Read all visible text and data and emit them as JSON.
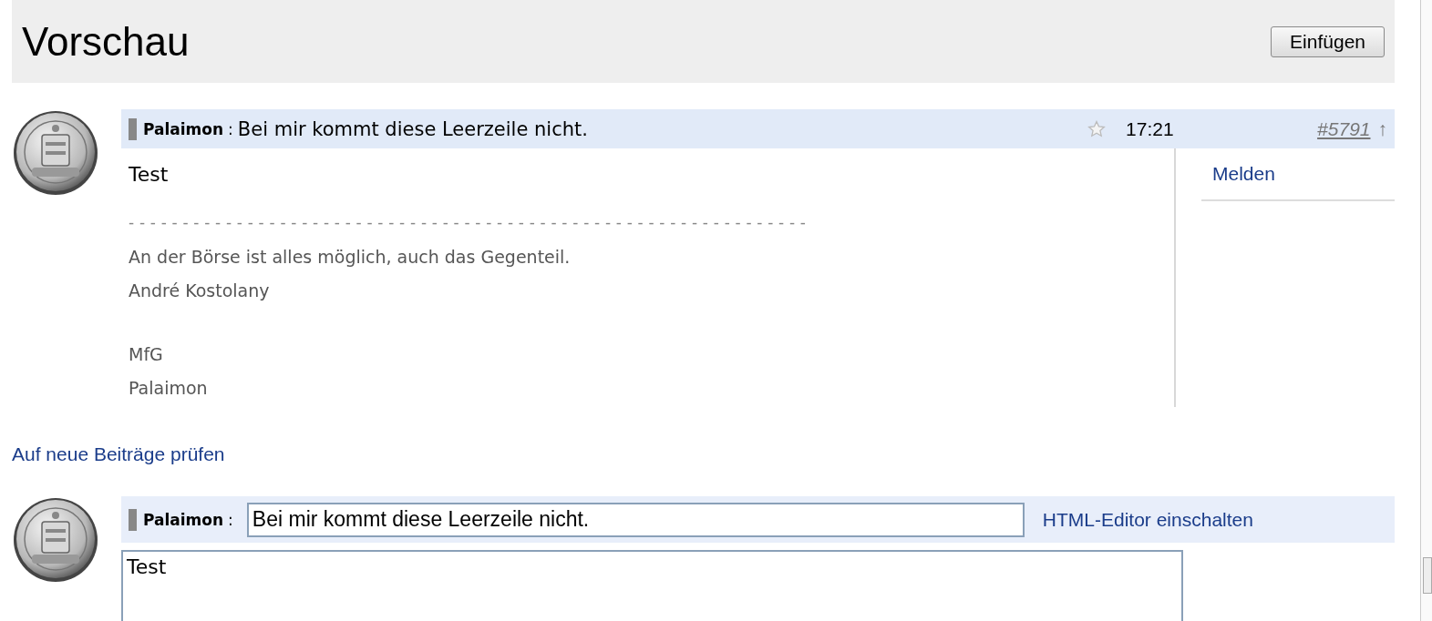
{
  "header": {
    "title": "Vorschau",
    "button": "Einfügen"
  },
  "post": {
    "author": "Palaimon",
    "separator": ":",
    "subject": "Bei mir kommt diese Leerzeile nicht.",
    "time": "17:21",
    "number": "#5791",
    "arrow": "↑",
    "body": "Test",
    "rule": "---------------------------------------------------------------",
    "signature": [
      [
        "An der Börse ist alles möglich, auch das Gegenteil.",
        "André Kostolany"
      ],
      [
        "MfG",
        "Palaimon"
      ]
    ],
    "action": "Melden"
  },
  "check_link": "Auf neue Beiträge prüfen",
  "editor": {
    "author": "Palaimon",
    "separator": ":",
    "subject": "Bei mir kommt diese Leerzeile nicht.",
    "editor_link": "HTML-Editor einschalten",
    "body": "Test"
  }
}
